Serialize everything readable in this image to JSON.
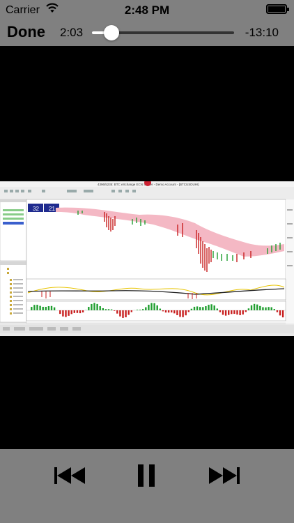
{
  "status_bar": {
    "carrier": "Carrier",
    "time": "2:48 PM"
  },
  "player": {
    "done_label": "Done",
    "elapsed": "2:03",
    "remaining": "-13:10",
    "progress_fraction": 0.135
  },
  "video": {
    "window_title": "4396/5235: BTC eXchange ECN Server - Demo Account - [BTCUSDUHI]",
    "market_watch_prices": [
      "32",
      "21"
    ],
    "colors": {
      "bull": "#1f9e2f",
      "bear": "#c81e1e",
      "cloud": "#f4b8c4",
      "panel_bg": "#ffffff"
    }
  },
  "icons": {
    "wifi": "wifi-icon",
    "battery": "battery-icon",
    "previous": "skip-back-icon",
    "pause": "pause-icon",
    "next": "skip-forward-icon"
  }
}
